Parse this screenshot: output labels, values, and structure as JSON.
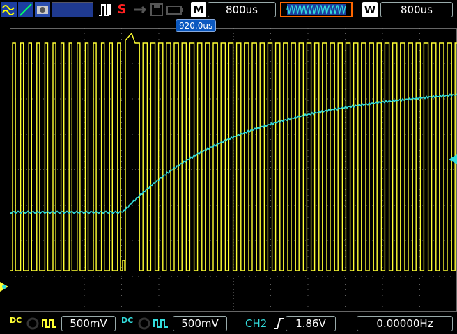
{
  "toolbar": {
    "mode_label": "M",
    "timebase": "800us",
    "window_label": "W",
    "window_timebase": "800us",
    "run_state_label": "S"
  },
  "trigger_cursor": {
    "position_label": "920.0us"
  },
  "channels": [
    {
      "name": "CH1",
      "coupling": "DC",
      "scale": "500mV",
      "color": "#ffff33"
    },
    {
      "name": "CH2",
      "coupling": "DC",
      "scale": "500mV",
      "color": "#33dddd"
    }
  ],
  "trigger": {
    "source": "CH2",
    "slope": "rising",
    "level": "1.86V",
    "frequency": "0.00000Hz"
  },
  "colors": {
    "grid": "#888888",
    "ch1": "#ffff33",
    "ch2": "#33dddd",
    "accent": "#ff6600"
  }
}
